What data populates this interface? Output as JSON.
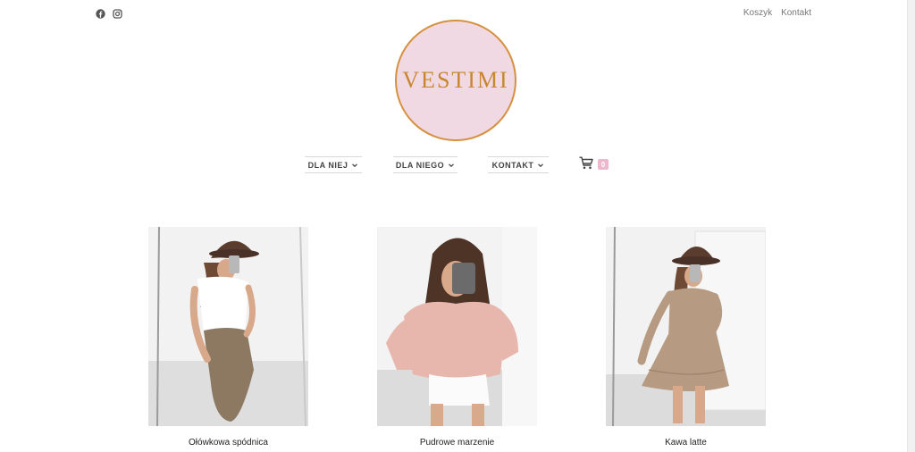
{
  "topbar": {
    "social_icons": [
      "facebook-icon",
      "instagram-icon"
    ],
    "links": [
      "Koszyk",
      "Kontakt"
    ]
  },
  "logo": {
    "text": "VESTIMI",
    "colors": {
      "fill": "#f1d9e3",
      "ring": "#d5913f",
      "text": "#c8862f"
    }
  },
  "nav": {
    "items": [
      {
        "label": "DLA NIEJ",
        "icon": "chevron-down-icon"
      },
      {
        "label": "DLA NIEGO",
        "icon": "chevron-down-icon"
      },
      {
        "label": "KONTAKT",
        "icon": "chevron-down-icon"
      }
    ],
    "cart": {
      "icon": "cart-icon",
      "count": "0",
      "badge_color": "#f1b6cb"
    }
  },
  "products": [
    {
      "title": "Ołówkowa spódnica",
      "image": "product-photo-1"
    },
    {
      "title": "Pudrowe marzenie",
      "image": "product-photo-2"
    },
    {
      "title": "Kawa latte",
      "image": "product-photo-3"
    }
  ]
}
